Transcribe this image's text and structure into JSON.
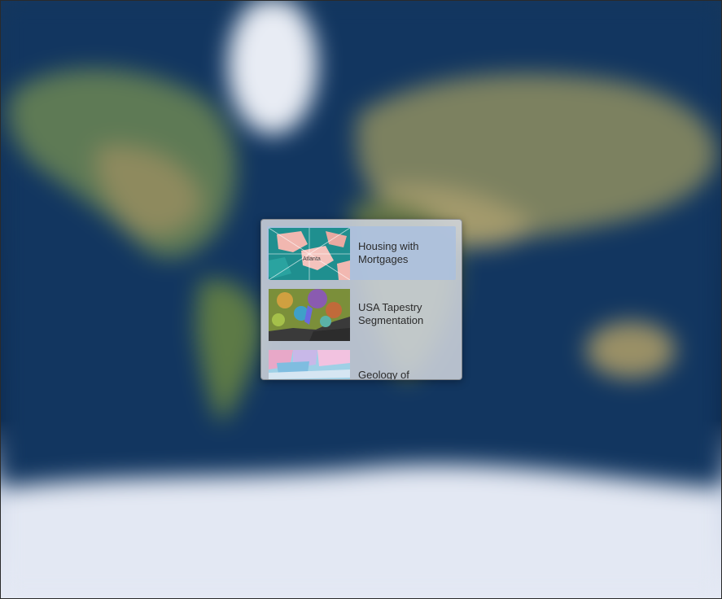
{
  "colors": {
    "selected_item_bg": "#aac0de",
    "popup_bg": "#d2d6de",
    "text": "#2b2b2b"
  },
  "map": {
    "icon": "world-basemap"
  },
  "gallery": {
    "items": [
      {
        "label": "Housing with Mortgages",
        "thumbnail": "teal-pink-choropleth",
        "thumb_text": "Atlanta",
        "selected": true
      },
      {
        "label": "USA Tapestry Segmentation",
        "thumbnail": "multicolor-segmentation-map",
        "selected": false
      },
      {
        "label": "Geology of",
        "thumbnail": "geology-map",
        "selected": false
      }
    ]
  }
}
